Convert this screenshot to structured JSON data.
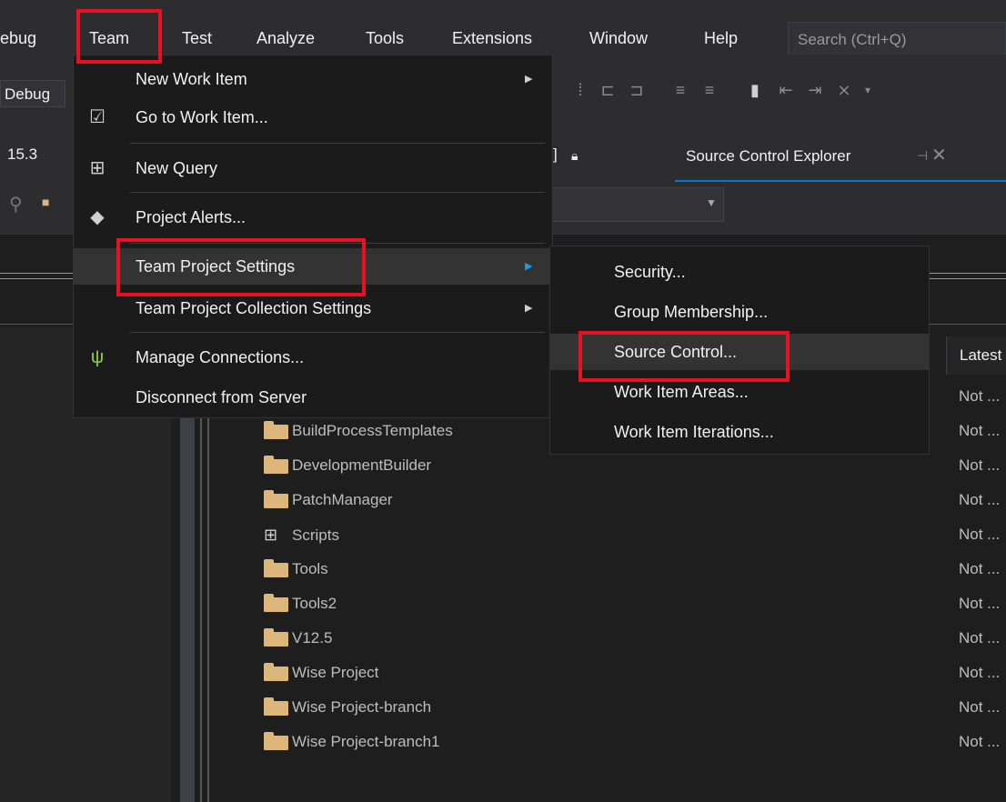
{
  "menubar": {
    "items": [
      "ebug",
      "Team",
      "Test",
      "Analyze",
      "Tools",
      "Extensions",
      "Window",
      "Help"
    ],
    "search_placeholder": "Search (Ctrl+Q)"
  },
  "toolbar": {
    "config": "Debug",
    "version": "15.3"
  },
  "tabs": {
    "partial_tab": "] ",
    "source_control_explorer": "Source Control Explorer"
  },
  "team_menu": {
    "items": [
      {
        "label": "New Work Item",
        "icon": "",
        "submenu": true
      },
      {
        "label": "Go to Work Item...",
        "icon": "go-to-work-item-icon",
        "submenu": false
      },
      {
        "label": "New Query",
        "icon": "new-query-icon",
        "submenu": false
      },
      {
        "label": "Project Alerts...",
        "icon": "project-alerts-icon",
        "submenu": false
      },
      {
        "label": "Team Project Settings",
        "icon": "",
        "submenu": true
      },
      {
        "label": "Team Project Collection Settings",
        "icon": "",
        "submenu": true
      },
      {
        "label": "Manage Connections...",
        "icon": "plug-icon",
        "submenu": false
      },
      {
        "label": "Disconnect from Server",
        "icon": "",
        "submenu": false
      }
    ]
  },
  "submenu": {
    "items": [
      "Security...",
      "Group Membership...",
      "Source Control...",
      "Work Item Areas...",
      "Work Item Iterations..."
    ]
  },
  "table": {
    "column_header": "Latest",
    "rows": [
      {
        "name": "BuildProcessTemplates",
        "type": "folder",
        "status": "Not ..."
      },
      {
        "name": "DevelopmentBuilder",
        "type": "folder",
        "status": "Not ..."
      },
      {
        "name": "PatchManager",
        "type": "folder",
        "status": "Not ..."
      },
      {
        "name": "Scripts",
        "type": "branch",
        "status": "Not ..."
      },
      {
        "name": "Tools",
        "type": "folder",
        "status": "Not ..."
      },
      {
        "name": "Tools2",
        "type": "folder",
        "status": "Not ..."
      },
      {
        "name": "V12.5",
        "type": "folder",
        "status": "Not ..."
      },
      {
        "name": "Wise Project",
        "type": "folder",
        "status": "Not ..."
      },
      {
        "name": "Wise Project-branch",
        "type": "folder",
        "status": "Not ..."
      },
      {
        "name": "Wise Project-branch1",
        "type": "folder",
        "status": "Not ..."
      }
    ],
    "extra_status": "Not ..."
  },
  "colors": {
    "highlight": "#e81123",
    "folder": "#dcb67a",
    "accent": "#007acc"
  }
}
